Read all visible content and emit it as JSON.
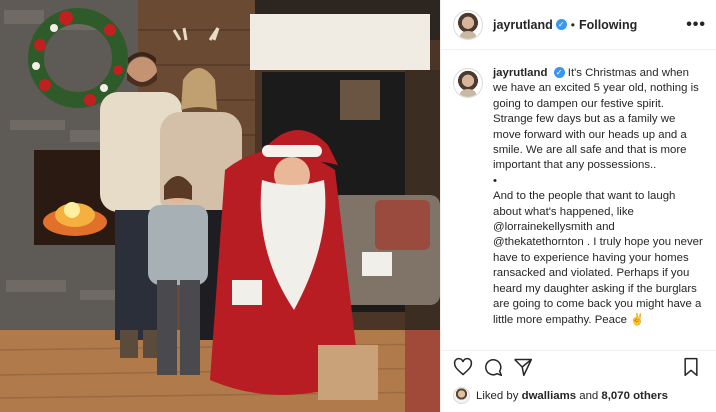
{
  "post": {
    "username": "jayrutland",
    "separator": "•",
    "follow_status": "Following",
    "more_label": "•••"
  },
  "caption": {
    "username": "jayrutland",
    "p1": "It's Christmas and when we have an excited 5 year old, nothing is going to dampen our festive spirit. Strange few days but as a family we move forward with our heads up and a smile. We are all safe and that is more important that any possessions..",
    "bullet": "•",
    "p2_a": "And to the people that want to laugh about what's happened, like",
    "mention1": "@lorrainekellysmith",
    "and": "and",
    "mention2": "@thekatethornton",
    "p2_b": ". I truly hope you never have to experience having your homes ransacked and violated. Perhaps if you heard my daughter asking if the burglars are going to come back you might have a little more empathy. Peace ✌️"
  },
  "likes": {
    "prefix": "Liked by",
    "user": "dwalliams",
    "and": "and",
    "count": "8,070 others"
  },
  "icons": [
    "heart-icon",
    "comment-icon",
    "share-icon",
    "bookmark-icon",
    "verified-badge-icon",
    "more-options-icon"
  ],
  "colors": {
    "verified": "#3897f0",
    "text": "#262626",
    "border": "#efefef"
  }
}
